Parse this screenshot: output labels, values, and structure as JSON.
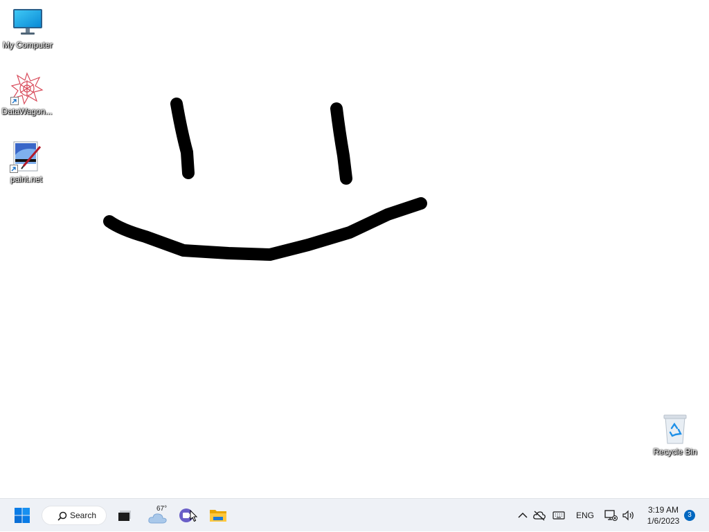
{
  "desktop": {
    "icons": [
      {
        "label": "My Computer",
        "icon": "monitor-icon"
      },
      {
        "label": "DataWagon...",
        "icon": "datawagon-app-icon"
      },
      {
        "label": "paint.net",
        "icon": "paintnet-app-icon"
      },
      {
        "label": "Recycle Bin",
        "icon": "recycle-bin-icon"
      }
    ],
    "drawing": "smiley-face-sketch"
  },
  "taskbar": {
    "start_icon": "windows-start-icon",
    "search_label": "Search",
    "weather_temp": "67°",
    "tray": {
      "language": "ENG",
      "time": "3:19 AM",
      "date": "1/6/2023",
      "notification_count": "3"
    }
  },
  "colors": {
    "taskbar_bg": "#eef1f6",
    "accent": "#0067c0",
    "ink": "#000000"
  }
}
